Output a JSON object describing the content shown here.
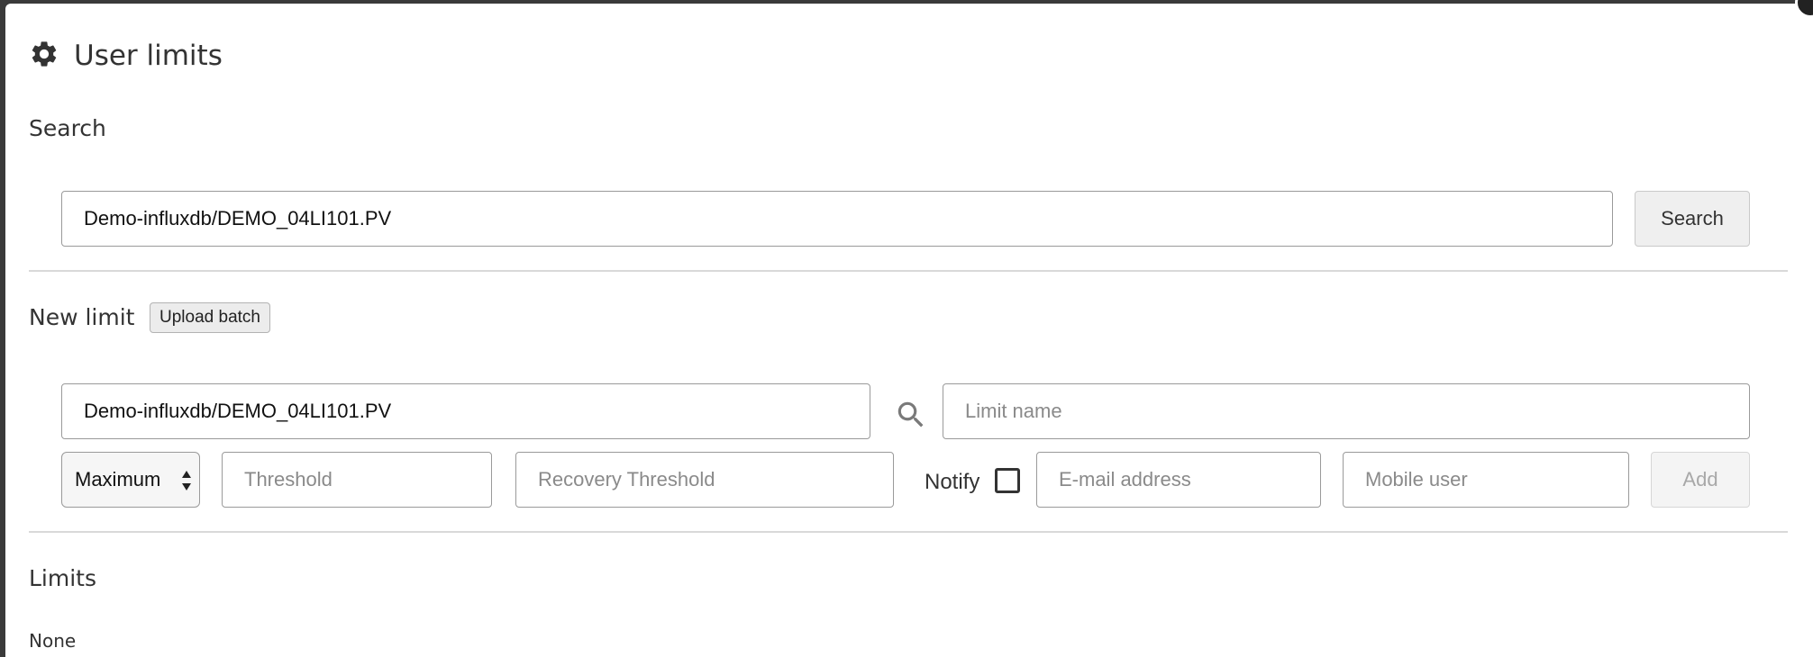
{
  "dialog": {
    "title": "User limits",
    "title_icon": "gear-icon"
  },
  "search": {
    "label": "Search",
    "value": "Demo-influxdb/DEMO_04LI101.PV",
    "button_label": "Search"
  },
  "new_limit": {
    "label": "New limit",
    "upload_label": "Upload batch",
    "path_value": "Demo-influxdb/DEMO_04LI101.PV",
    "limit_name_placeholder": "Limit name",
    "type_selected": "Maximum",
    "threshold_placeholder": "Threshold",
    "recovery_placeholder": "Recovery Threshold",
    "notify_label": "Notify",
    "notify_checked": false,
    "email_placeholder": "E-mail address",
    "mobile_placeholder": "Mobile user",
    "add_label": "Add"
  },
  "limits": {
    "label": "Limits",
    "empty_text": "None"
  }
}
